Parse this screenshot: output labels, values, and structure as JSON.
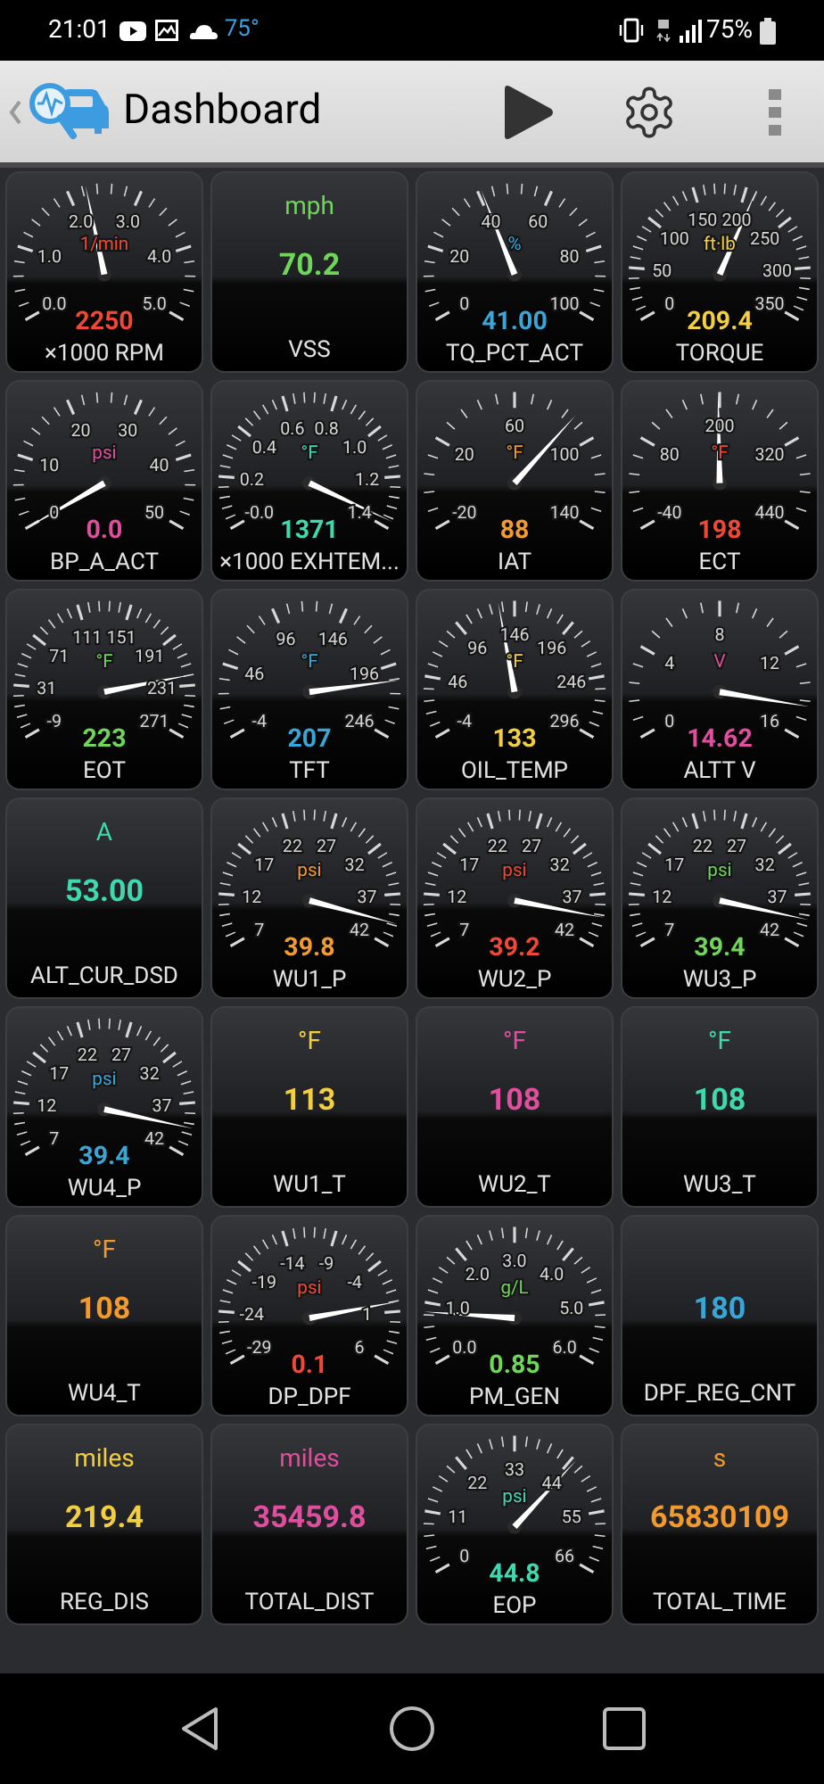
{
  "status_bar": {
    "time": "21:01",
    "temperature": "75°",
    "battery": "75%"
  },
  "app_bar": {
    "title": "Dashboard"
  },
  "gauges": [
    {
      "kind": "dial",
      "name": "×1000 RPM",
      "unit": "1/min",
      "value": "2250",
      "color": "#ef4836",
      "scale": [
        "2.0",
        "3.0",
        "1.0",
        "4.0",
        "0.0",
        "5.0"
      ]
    },
    {
      "kind": "digital",
      "name": "VSS",
      "unit": "mph",
      "value": "70.2",
      "color": "#6fd65a"
    },
    {
      "kind": "dial",
      "name": "TQ_PCT_ACT",
      "unit": "%",
      "value": "41.00",
      "color": "#3aa6d8",
      "scale": [
        "40",
        "60",
        "20",
        "80",
        "0",
        "100"
      ]
    },
    {
      "kind": "dial",
      "name": "TORQUE",
      "unit": "ft·lb",
      "value": "209.4",
      "color": "#f3cf3f",
      "scale": [
        "150",
        "200",
        "100",
        "250",
        "50",
        "300",
        "0",
        "350"
      ]
    },
    {
      "kind": "dial",
      "name": "BP_A_ACT",
      "unit": "psi",
      "value": "0.0",
      "color": "#df4f9e",
      "scale": [
        "20",
        "30",
        "10",
        "40",
        "0",
        "50"
      ]
    },
    {
      "kind": "dial",
      "name": "×1000 EXHTEM...",
      "unit": "°F",
      "value": "1371",
      "color": "#3fd9b0",
      "scale": [
        "0.6",
        "0.8",
        "0.4",
        "1.0",
        "0.2",
        "1.2",
        "-0.0",
        "1.4"
      ]
    },
    {
      "kind": "dial",
      "name": "IAT",
      "unit": "°F",
      "value": "88",
      "color": "#f29a2e",
      "scale": [
        "60",
        "20",
        "100",
        "-20",
        "140"
      ]
    },
    {
      "kind": "dial",
      "name": "ECT",
      "unit": "°F",
      "value": "198",
      "color": "#ef4836",
      "scale": [
        "200",
        "80",
        "320",
        "-40",
        "440"
      ]
    },
    {
      "kind": "dial",
      "name": "EOT",
      "unit": "°F",
      "value": "223",
      "color": "#6fd65a",
      "scale": [
        "111",
        "151",
        "71",
        "191",
        "31",
        "231",
        "-9",
        "271"
      ]
    },
    {
      "kind": "dial",
      "name": "TFT",
      "unit": "°F",
      "value": "207",
      "color": "#3aa6d8",
      "scale": [
        "96",
        "146",
        "46",
        "196",
        "-4",
        "246"
      ]
    },
    {
      "kind": "dial",
      "name": "OIL_TEMP",
      "unit": "°F",
      "value": "133",
      "color": "#f3cf3f",
      "scale": [
        "146",
        "96",
        "196",
        "46",
        "246",
        "-4",
        "296"
      ]
    },
    {
      "kind": "dial",
      "name": "ALTT V",
      "unit": "V",
      "value": "14.62",
      "color": "#df4f9e",
      "scale": [
        "8",
        "4",
        "12",
        "0",
        "16"
      ]
    },
    {
      "kind": "digital",
      "name": "ALT_CUR_DSD",
      "unit": "A",
      "value": "53.00",
      "color": "#3fd9b0"
    },
    {
      "kind": "dial",
      "name": "WU1_P",
      "unit": "psi",
      "value": "39.8",
      "color": "#f29a2e",
      "scale": [
        "22",
        "27",
        "17",
        "32",
        "12",
        "37",
        "7",
        "42"
      ]
    },
    {
      "kind": "dial",
      "name": "WU2_P",
      "unit": "psi",
      "value": "39.2",
      "color": "#ef4836",
      "scale": [
        "22",
        "27",
        "17",
        "32",
        "12",
        "37",
        "7",
        "42"
      ]
    },
    {
      "kind": "dial",
      "name": "WU3_P",
      "unit": "psi",
      "value": "39.4",
      "color": "#6fd65a",
      "scale": [
        "22",
        "27",
        "17",
        "32",
        "12",
        "37",
        "7",
        "42"
      ]
    },
    {
      "kind": "dial",
      "name": "WU4_P",
      "unit": "psi",
      "value": "39.4",
      "color": "#3aa6d8",
      "scale": [
        "22",
        "27",
        "17",
        "32",
        "12",
        "37",
        "7",
        "42"
      ]
    },
    {
      "kind": "digital",
      "name": "WU1_T",
      "unit": "°F",
      "value": "113",
      "color": "#f3cf3f"
    },
    {
      "kind": "digital",
      "name": "WU2_T",
      "unit": "°F",
      "value": "108",
      "color": "#df4f9e"
    },
    {
      "kind": "digital",
      "name": "WU3_T",
      "unit": "°F",
      "value": "108",
      "color": "#3fd9b0"
    },
    {
      "kind": "digital",
      "name": "WU4_T",
      "unit": "°F",
      "value": "108",
      "color": "#f29a2e"
    },
    {
      "kind": "dial",
      "name": "DP_DPF",
      "unit": "psi",
      "value": "0.1",
      "color": "#ef4836",
      "scale": [
        "-14",
        "-9",
        "-19",
        "-4",
        "-24",
        "1",
        "-29",
        "6"
      ]
    },
    {
      "kind": "dial",
      "name": "PM_GEN",
      "unit": "g/L",
      "value": "0.85",
      "color": "#6fd65a",
      "scale": [
        "3.0",
        "2.0",
        "4.0",
        "1.0",
        "5.0",
        "0.0",
        "6.0"
      ]
    },
    {
      "kind": "digital",
      "name": "DPF_REG_CNT",
      "value": "180",
      "color": "#3aa6d8"
    },
    {
      "kind": "digital",
      "name": "REG_DIS",
      "unit": "miles",
      "value": "219.4",
      "color": "#f3cf3f"
    },
    {
      "kind": "digital",
      "name": "TOTAL_DIST",
      "unit": "miles",
      "value": "35459.8",
      "color": "#df4f9e"
    },
    {
      "kind": "dial",
      "name": "EOP",
      "unit": "psi",
      "value": "44.8",
      "color": "#3fd9b0",
      "scale": [
        "33",
        "22",
        "44",
        "11",
        "55",
        "0",
        "66"
      ]
    },
    {
      "kind": "digital",
      "name": "TOTAL_TIME",
      "unit": "s",
      "value": "65830109",
      "color": "#f29a2e"
    }
  ]
}
